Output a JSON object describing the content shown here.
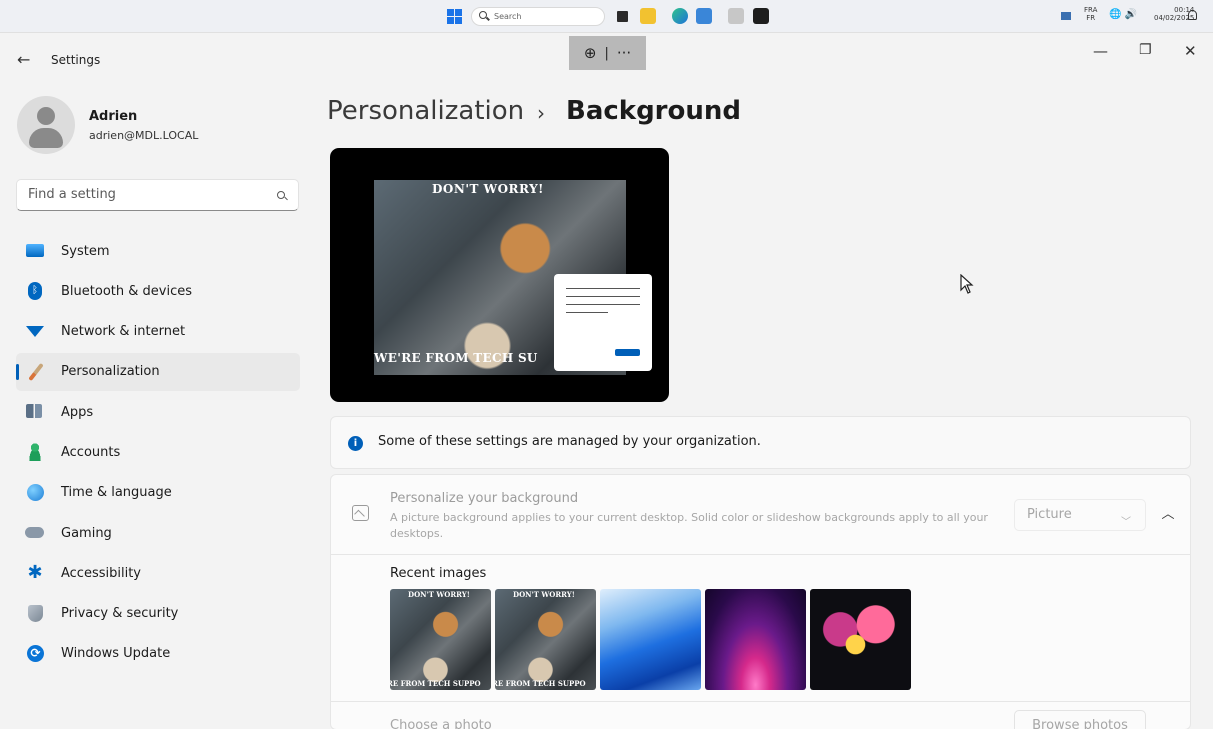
{
  "taskbar": {
    "search_placeholder": "Search",
    "lang_top": "FRA",
    "lang_bottom": "FR",
    "time": "00:14",
    "date": "04/02/2025",
    "icons": [
      "start-icon",
      "task-view-icon",
      "file-explorer-icon",
      "edge-icon",
      "network-app-icon",
      "installer-icon",
      "terminal-icon"
    ]
  },
  "window": {
    "back_icon": "back-arrow-icon",
    "title": "Settings",
    "zoom_icon": "zoom-in-icon",
    "more_icon": "more-icon"
  },
  "user": {
    "name": "Adrien",
    "email": "adrien@MDL.LOCAL"
  },
  "search": {
    "placeholder": "Find a setting"
  },
  "nav": [
    {
      "label": "System",
      "icon": "system-icon",
      "active": false
    },
    {
      "label": "Bluetooth & devices",
      "icon": "bluetooth-icon",
      "active": false
    },
    {
      "label": "Network & internet",
      "icon": "wifi-icon",
      "active": false
    },
    {
      "label": "Personalization",
      "icon": "brush-icon",
      "active": true
    },
    {
      "label": "Apps",
      "icon": "apps-icon",
      "active": false
    },
    {
      "label": "Accounts",
      "icon": "accounts-icon",
      "active": false
    },
    {
      "label": "Time & language",
      "icon": "clock-globe-icon",
      "active": false
    },
    {
      "label": "Gaming",
      "icon": "gamepad-icon",
      "active": false
    },
    {
      "label": "Accessibility",
      "icon": "accessibility-icon",
      "active": false
    },
    {
      "label": "Privacy & security",
      "icon": "shield-icon",
      "active": false
    },
    {
      "label": "Windows Update",
      "icon": "update-icon",
      "active": false
    }
  ],
  "breadcrumb": {
    "parent": "Personalization",
    "separator": "›",
    "current": "Background"
  },
  "preview": {
    "caption_top": "DON'T WORRY!",
    "caption_bottom": "WE'RE FROM TECH SU"
  },
  "info": {
    "text": "Some of these settings are managed by your organization."
  },
  "background_card": {
    "title": "Personalize your background",
    "description": "A picture background applies to your current desktop. Solid color or slideshow backgrounds apply to all your desktops.",
    "selected": "Picture",
    "recent_label": "Recent images",
    "thumb_caption_top": "DON'T WORRY!",
    "thumb_caption_bottom": "RE FROM TECH SUPPO",
    "choose_label": "Choose a photo",
    "browse_label": "Browse photos"
  },
  "colors": {
    "accent": "#005fb8",
    "sidebar_active": "#e9e9e9",
    "background": "#f3f3f3"
  }
}
